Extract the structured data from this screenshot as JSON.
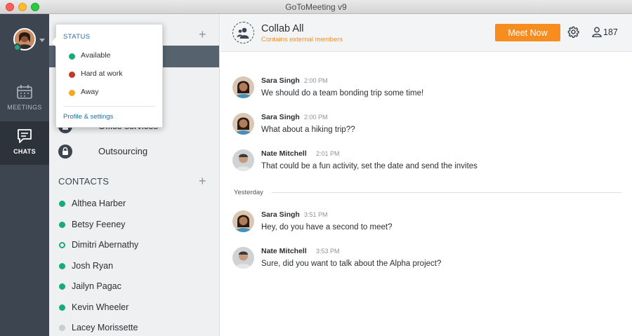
{
  "window": {
    "title": "GoToMeeting v9"
  },
  "rail": {
    "items": [
      {
        "label": "MEETINGS",
        "icon": "calendar-icon",
        "active": false
      },
      {
        "label": "CHATS",
        "icon": "chat-bubble-icon",
        "active": true
      }
    ]
  },
  "status_menu": {
    "heading": "STATUS",
    "options": [
      {
        "label": "Available",
        "color": "#1aa979"
      },
      {
        "label": "Hard at work",
        "color": "#c0392b"
      },
      {
        "label": "Away",
        "color": "#f5a623"
      }
    ],
    "profile_link": "Profile & settings"
  },
  "sidebar": {
    "groups": [
      {
        "name": "Office services",
        "icon": "lock-icon"
      },
      {
        "name": "Outsourcing",
        "icon": "lock-icon"
      }
    ],
    "contacts_heading": "CONTACTS",
    "contacts": [
      {
        "name": "Althea Harber",
        "status": "available"
      },
      {
        "name": "Betsy Feeney",
        "status": "available"
      },
      {
        "name": "Dimitri Abernathy",
        "status": "idle"
      },
      {
        "name": "Josh Ryan",
        "status": "available"
      },
      {
        "name": "Jailyn Pagac",
        "status": "available"
      },
      {
        "name": "Kevin Wheeler",
        "status": "available"
      },
      {
        "name": "Lacey Morissette",
        "status": "offline"
      }
    ]
  },
  "chat": {
    "title": "Collab All",
    "subtitle": "Contains external members",
    "meet_now_label": "Meet Now",
    "member_count": "187",
    "date_separator": "Yesterday",
    "messages": [
      {
        "sender": "Sara Singh",
        "time": "2:00 PM",
        "text": "We should do a team bonding trip some time!"
      },
      {
        "sender": "Sara Singh",
        "time": "2:00 PM",
        "text": "What about a hiking trip??"
      },
      {
        "sender": "Nate Mitchell",
        "time": "2:01 PM",
        "text": "That could be a fun activity, set the date and send the invites"
      },
      {
        "sender": "Sara Singh",
        "time": "3:51 PM",
        "text": "Hey, do you have a second to meet?"
      },
      {
        "sender": "Nate Mitchell",
        "time": "3:53 PM",
        "text": "Sure, did you want to talk about the Alpha project?"
      }
    ]
  },
  "colors": {
    "accent": "#f68d1e",
    "rail": "#3d4650",
    "available": "#1aa979"
  }
}
